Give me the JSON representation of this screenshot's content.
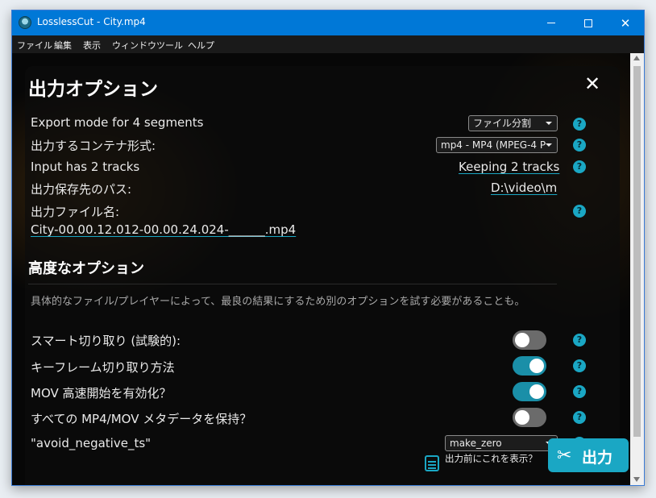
{
  "window": {
    "title": "LosslessCut - City.mp4"
  },
  "menu": [
    "ファイル",
    "編集",
    "表示",
    "ウィンドウ",
    "ツール",
    "ヘルプ"
  ],
  "dialog": {
    "title": "出力オプション",
    "rows": {
      "export_mode": {
        "label": "Export mode for 4 segments",
        "value": "ファイル分割"
      },
      "container": {
        "label": "出力するコンテナ形式:",
        "value": "mp4 - MP4 (MPEG-4 P"
      },
      "tracks": {
        "label": "Input has 2 tracks",
        "value": "Keeping 2 tracks"
      },
      "output_path": {
        "label": "出力保存先のパス:",
        "value": "D:\\video\\m"
      },
      "output_name": {
        "label": "出力ファイル名:",
        "value": "City-00.00.12.012-00.00.24.024-______.mp4"
      }
    },
    "advanced": {
      "title": "高度なオプション",
      "description": "具体的なファイル/プレイヤーによって、最良の結果にするため別のオプションを試す必要があることも。",
      "smart_cut": {
        "label": "スマート切り取り (試験的):",
        "on": false
      },
      "keyframe_cut": {
        "label": "キーフレーム切り取り方法",
        "on": true
      },
      "mov_faststart": {
        "label": "MOV 高速開始を有効化？",
        "on": true
      },
      "preserve_metadata": {
        "label": "すべての MP4/MOV メタデータを保持？",
        "on": false
      },
      "avoid_negative_ts": {
        "label": "\"avoid_negative_ts\"",
        "value": "make_zero"
      }
    },
    "help_glyph": "?",
    "preview_label": "出力前にこれを表示？",
    "export_label": "出力",
    "close_glyph": "✕"
  },
  "colors": {
    "accent": "#1aa7c4",
    "titlebar": "#0078d7",
    "background": "#070707"
  }
}
